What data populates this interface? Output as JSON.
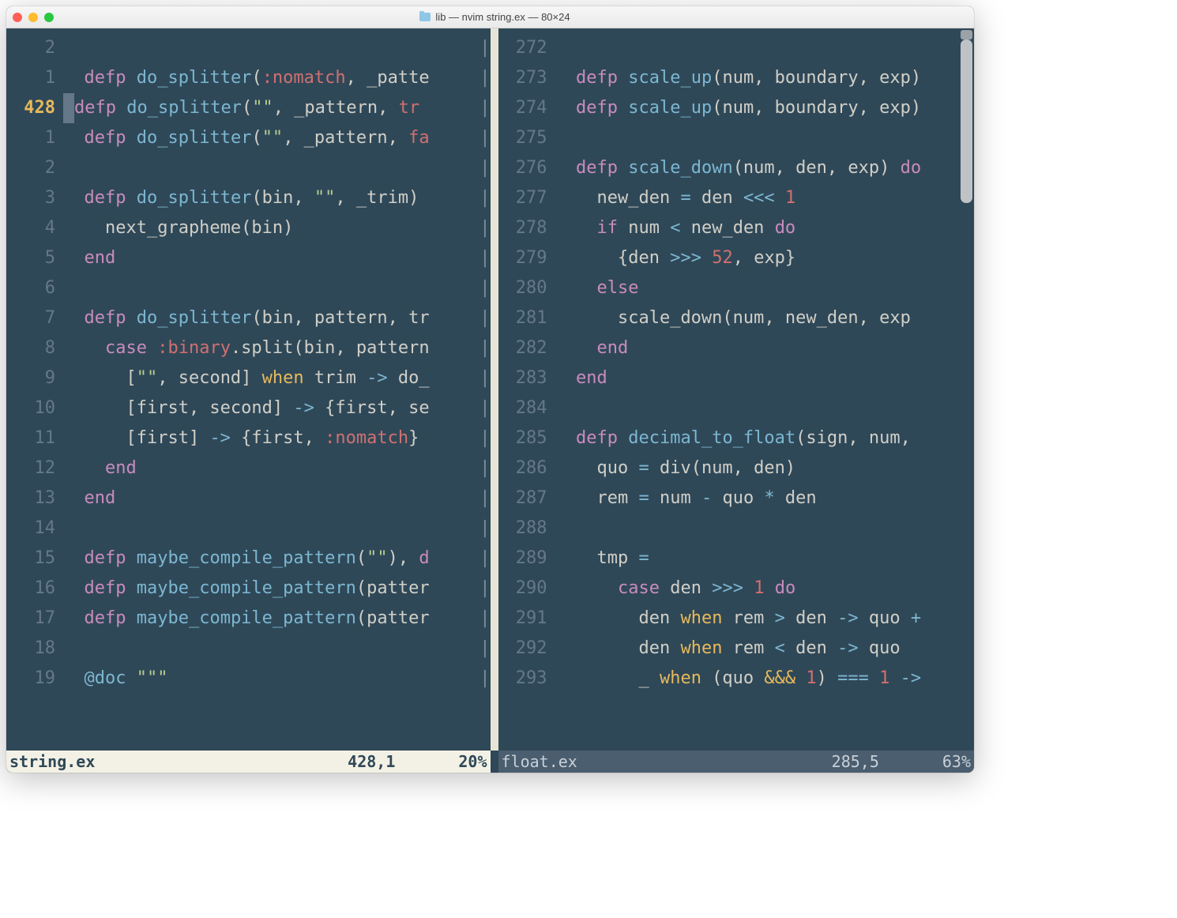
{
  "titlebar": {
    "dots": {
      "close": "#ff5f57",
      "min": "#febc2e",
      "max": "#28c840"
    },
    "title": "lib — nvim string.ex — 80×24"
  },
  "status": {
    "left_file": "string.ex",
    "left_pos": "428,1",
    "left_pct": "20%",
    "right_file": "float.ex",
    "right_pos": "285,5",
    "right_pct": "63%"
  },
  "left_pane": {
    "rows": [
      {
        "ln": "2",
        "cur": false,
        "tokens": []
      },
      {
        "ln": "1",
        "cur": false,
        "tokens": [
          {
            "c": "plain",
            "t": "  "
          },
          {
            "c": "kw",
            "t": "defp "
          },
          {
            "c": "fn",
            "t": "do_splitter"
          },
          {
            "c": "plain",
            "t": "("
          },
          {
            "c": "atom",
            "t": ":nomatch"
          },
          {
            "c": "plain",
            "t": ", "
          },
          {
            "c": "plain",
            "t": "_patte"
          }
        ]
      },
      {
        "ln": "428",
        "cur": true,
        "cursor": true,
        "tokens": [
          {
            "c": "kw",
            "t": "defp "
          },
          {
            "c": "fn",
            "t": "do_splitter"
          },
          {
            "c": "plain",
            "t": "("
          },
          {
            "c": "str",
            "t": "\"\""
          },
          {
            "c": "plain",
            "t": ", _pattern, "
          },
          {
            "c": "bool",
            "t": "tr"
          }
        ]
      },
      {
        "ln": "1",
        "cur": false,
        "tokens": [
          {
            "c": "plain",
            "t": "  "
          },
          {
            "c": "kw",
            "t": "defp "
          },
          {
            "c": "fn",
            "t": "do_splitter"
          },
          {
            "c": "plain",
            "t": "("
          },
          {
            "c": "str",
            "t": "\"\""
          },
          {
            "c": "plain",
            "t": ", _pattern, "
          },
          {
            "c": "bool",
            "t": "fa"
          }
        ]
      },
      {
        "ln": "2",
        "cur": false,
        "tokens": []
      },
      {
        "ln": "3",
        "cur": false,
        "tokens": [
          {
            "c": "plain",
            "t": "  "
          },
          {
            "c": "kw",
            "t": "defp "
          },
          {
            "c": "fn",
            "t": "do_splitter"
          },
          {
            "c": "plain",
            "t": "(bin, "
          },
          {
            "c": "str",
            "t": "\"\""
          },
          {
            "c": "plain",
            "t": ", _trim) "
          }
        ]
      },
      {
        "ln": "4",
        "cur": false,
        "tokens": [
          {
            "c": "plain",
            "t": "    next_grapheme(bin)"
          }
        ]
      },
      {
        "ln": "5",
        "cur": false,
        "tokens": [
          {
            "c": "plain",
            "t": "  "
          },
          {
            "c": "kw",
            "t": "end"
          }
        ]
      },
      {
        "ln": "6",
        "cur": false,
        "tokens": []
      },
      {
        "ln": "7",
        "cur": false,
        "tokens": [
          {
            "c": "plain",
            "t": "  "
          },
          {
            "c": "kw",
            "t": "defp "
          },
          {
            "c": "fn",
            "t": "do_splitter"
          },
          {
            "c": "plain",
            "t": "(bin, pattern, tr"
          }
        ]
      },
      {
        "ln": "8",
        "cur": false,
        "tokens": [
          {
            "c": "plain",
            "t": "    "
          },
          {
            "c": "kw",
            "t": "case "
          },
          {
            "c": "atom",
            "t": ":binary"
          },
          {
            "c": "plain",
            "t": ".split(bin, pattern"
          }
        ]
      },
      {
        "ln": "9",
        "cur": false,
        "tokens": [
          {
            "c": "plain",
            "t": "      ["
          },
          {
            "c": "str",
            "t": "\"\""
          },
          {
            "c": "plain",
            "t": ", second] "
          },
          {
            "c": "yellow",
            "t": "when"
          },
          {
            "c": "plain",
            "t": " trim "
          },
          {
            "c": "op",
            "t": "->"
          },
          {
            "c": "plain",
            "t": " do_"
          }
        ]
      },
      {
        "ln": "10",
        "cur": false,
        "tokens": [
          {
            "c": "plain",
            "t": "      [first, second] "
          },
          {
            "c": "op",
            "t": "->"
          },
          {
            "c": "plain",
            "t": " {first, se"
          }
        ]
      },
      {
        "ln": "11",
        "cur": false,
        "tokens": [
          {
            "c": "plain",
            "t": "      [first] "
          },
          {
            "c": "op",
            "t": "->"
          },
          {
            "c": "plain",
            "t": " {first, "
          },
          {
            "c": "atom",
            "t": ":nomatch"
          },
          {
            "c": "plain",
            "t": "} "
          }
        ]
      },
      {
        "ln": "12",
        "cur": false,
        "tokens": [
          {
            "c": "plain",
            "t": "    "
          },
          {
            "c": "kw",
            "t": "end"
          }
        ]
      },
      {
        "ln": "13",
        "cur": false,
        "tokens": [
          {
            "c": "plain",
            "t": "  "
          },
          {
            "c": "kw",
            "t": "end"
          }
        ]
      },
      {
        "ln": "14",
        "cur": false,
        "tokens": []
      },
      {
        "ln": "15",
        "cur": false,
        "tokens": [
          {
            "c": "plain",
            "t": "  "
          },
          {
            "c": "kw",
            "t": "defp "
          },
          {
            "c": "fn",
            "t": "maybe_compile_pattern"
          },
          {
            "c": "plain",
            "t": "("
          },
          {
            "c": "str",
            "t": "\"\""
          },
          {
            "c": "plain",
            "t": "), "
          },
          {
            "c": "kw",
            "t": "d"
          }
        ]
      },
      {
        "ln": "16",
        "cur": false,
        "tokens": [
          {
            "c": "plain",
            "t": "  "
          },
          {
            "c": "kw",
            "t": "defp "
          },
          {
            "c": "fn",
            "t": "maybe_compile_pattern"
          },
          {
            "c": "plain",
            "t": "(patter"
          }
        ]
      },
      {
        "ln": "17",
        "cur": false,
        "tokens": [
          {
            "c": "plain",
            "t": "  "
          },
          {
            "c": "kw",
            "t": "defp "
          },
          {
            "c": "fn",
            "t": "maybe_compile_pattern"
          },
          {
            "c": "plain",
            "t": "(patter"
          }
        ]
      },
      {
        "ln": "18",
        "cur": false,
        "tokens": []
      },
      {
        "ln": "19",
        "cur": false,
        "tokens": [
          {
            "c": "plain",
            "t": "  "
          },
          {
            "c": "attr",
            "t": "@doc "
          },
          {
            "c": "doc",
            "t": "\"\"\""
          }
        ]
      }
    ]
  },
  "right_pane": {
    "rows": [
      {
        "ln": "272",
        "tokens": []
      },
      {
        "ln": "273",
        "tokens": [
          {
            "c": "plain",
            "t": "  "
          },
          {
            "c": "kw",
            "t": "defp "
          },
          {
            "c": "fn",
            "t": "scale_up"
          },
          {
            "c": "plain",
            "t": "(num, boundary, exp)"
          }
        ]
      },
      {
        "ln": "274",
        "tokens": [
          {
            "c": "plain",
            "t": "  "
          },
          {
            "c": "kw",
            "t": "defp "
          },
          {
            "c": "fn",
            "t": "scale_up"
          },
          {
            "c": "plain",
            "t": "(num, boundary, exp)"
          }
        ]
      },
      {
        "ln": "275",
        "tokens": []
      },
      {
        "ln": "276",
        "tokens": [
          {
            "c": "plain",
            "t": "  "
          },
          {
            "c": "kw",
            "t": "defp "
          },
          {
            "c": "fn",
            "t": "scale_down"
          },
          {
            "c": "plain",
            "t": "(num, den, exp) "
          },
          {
            "c": "kw",
            "t": "do"
          }
        ]
      },
      {
        "ln": "277",
        "tokens": [
          {
            "c": "plain",
            "t": "    new_den "
          },
          {
            "c": "op",
            "t": "="
          },
          {
            "c": "plain",
            "t": " den "
          },
          {
            "c": "op",
            "t": "<<<"
          },
          {
            "c": "plain",
            "t": " "
          },
          {
            "c": "num",
            "t": "1"
          }
        ]
      },
      {
        "ln": "278",
        "tokens": [
          {
            "c": "plain",
            "t": "    "
          },
          {
            "c": "kw",
            "t": "if"
          },
          {
            "c": "plain",
            "t": " num "
          },
          {
            "c": "op",
            "t": "<"
          },
          {
            "c": "plain",
            "t": " new_den "
          },
          {
            "c": "kw",
            "t": "do"
          }
        ]
      },
      {
        "ln": "279",
        "tokens": [
          {
            "c": "plain",
            "t": "      {den "
          },
          {
            "c": "op",
            "t": ">>>"
          },
          {
            "c": "plain",
            "t": " "
          },
          {
            "c": "num",
            "t": "52"
          },
          {
            "c": "plain",
            "t": ", exp}"
          }
        ]
      },
      {
        "ln": "280",
        "tokens": [
          {
            "c": "plain",
            "t": "    "
          },
          {
            "c": "kw",
            "t": "else"
          }
        ]
      },
      {
        "ln": "281",
        "tokens": [
          {
            "c": "plain",
            "t": "      scale_down(num, new_den, exp"
          }
        ]
      },
      {
        "ln": "282",
        "tokens": [
          {
            "c": "plain",
            "t": "    "
          },
          {
            "c": "kw",
            "t": "end"
          }
        ]
      },
      {
        "ln": "283",
        "tokens": [
          {
            "c": "plain",
            "t": "  "
          },
          {
            "c": "kw",
            "t": "end"
          }
        ]
      },
      {
        "ln": "284",
        "tokens": []
      },
      {
        "ln": "285",
        "tokens": [
          {
            "c": "plain",
            "t": "  "
          },
          {
            "c": "kw",
            "t": "defp "
          },
          {
            "c": "fn",
            "t": "decimal_to_float"
          },
          {
            "c": "plain",
            "t": "(sign, num,"
          }
        ]
      },
      {
        "ln": "286",
        "tokens": [
          {
            "c": "plain",
            "t": "    quo "
          },
          {
            "c": "op",
            "t": "="
          },
          {
            "c": "plain",
            "t": " div(num, den)"
          }
        ]
      },
      {
        "ln": "287",
        "tokens": [
          {
            "c": "plain",
            "t": "    rem "
          },
          {
            "c": "op",
            "t": "="
          },
          {
            "c": "plain",
            "t": " num "
          },
          {
            "c": "op",
            "t": "-"
          },
          {
            "c": "plain",
            "t": " quo "
          },
          {
            "c": "op",
            "t": "*"
          },
          {
            "c": "plain",
            "t": " den"
          }
        ]
      },
      {
        "ln": "288",
        "tokens": []
      },
      {
        "ln": "289",
        "tokens": [
          {
            "c": "plain",
            "t": "    tmp "
          },
          {
            "c": "op",
            "t": "="
          }
        ]
      },
      {
        "ln": "290",
        "tokens": [
          {
            "c": "plain",
            "t": "      "
          },
          {
            "c": "kw",
            "t": "case"
          },
          {
            "c": "plain",
            "t": " den "
          },
          {
            "c": "op",
            "t": ">>>"
          },
          {
            "c": "plain",
            "t": " "
          },
          {
            "c": "num",
            "t": "1"
          },
          {
            "c": "plain",
            "t": " "
          },
          {
            "c": "kw",
            "t": "do"
          }
        ]
      },
      {
        "ln": "291",
        "tokens": [
          {
            "c": "plain",
            "t": "        den "
          },
          {
            "c": "yellow",
            "t": "when"
          },
          {
            "c": "plain",
            "t": " rem "
          },
          {
            "c": "op",
            "t": ">"
          },
          {
            "c": "plain",
            "t": " den "
          },
          {
            "c": "op",
            "t": "->"
          },
          {
            "c": "plain",
            "t": " quo "
          },
          {
            "c": "op",
            "t": "+"
          }
        ]
      },
      {
        "ln": "292",
        "tokens": [
          {
            "c": "plain",
            "t": "        den "
          },
          {
            "c": "yellow",
            "t": "when"
          },
          {
            "c": "plain",
            "t": " rem "
          },
          {
            "c": "op",
            "t": "<"
          },
          {
            "c": "plain",
            "t": " den "
          },
          {
            "c": "op",
            "t": "->"
          },
          {
            "c": "plain",
            "t": " quo"
          }
        ]
      },
      {
        "ln": "293",
        "tokens": [
          {
            "c": "plain",
            "t": "        _ "
          },
          {
            "c": "yellow",
            "t": "when"
          },
          {
            "c": "plain",
            "t": " (quo "
          },
          {
            "c": "yellow",
            "t": "&&&"
          },
          {
            "c": "plain",
            "t": " "
          },
          {
            "c": "num",
            "t": "1"
          },
          {
            "c": "plain",
            "t": ") "
          },
          {
            "c": "op",
            "t": "==="
          },
          {
            "c": "plain",
            "t": " "
          },
          {
            "c": "num",
            "t": "1"
          },
          {
            "c": "plain",
            "t": " "
          },
          {
            "c": "op",
            "t": "->"
          }
        ]
      }
    ]
  }
}
